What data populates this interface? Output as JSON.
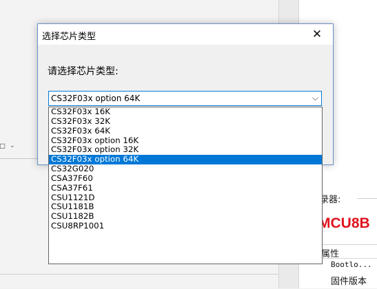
{
  "background": {
    "right_panel": {
      "label_partial": "录器:",
      "title_partial": "MCU8B",
      "attr_label_partial": "属性",
      "bootloader_partial": "Bootlo...",
      "firmware_partial": "固件版本"
    }
  },
  "dialog": {
    "title": "选择芯片类型",
    "close_glyph": "✕",
    "prompt": "请选择芯片类型:",
    "select_value": "CS32F03x option 64K",
    "select_arrow": "⌵"
  },
  "dropdown": {
    "options": [
      "CS32F03x 16K",
      "CS32F03x 32K",
      "CS32F03x 64K",
      "CS32F03x option 16K",
      "CS32F03x option 32K",
      "CS32F03x option 64K",
      "CS32G020",
      "CSA37F60",
      "CSA37F61",
      "CSU1121D",
      "CSU1181B",
      "CSU1182B",
      "CSU8RP1001"
    ],
    "selected_value": "CS32F03x option 64K"
  },
  "colors": {
    "selection": "#0078d7",
    "dialog_border": "#6a8fc8",
    "title_red": "#e0141e"
  }
}
